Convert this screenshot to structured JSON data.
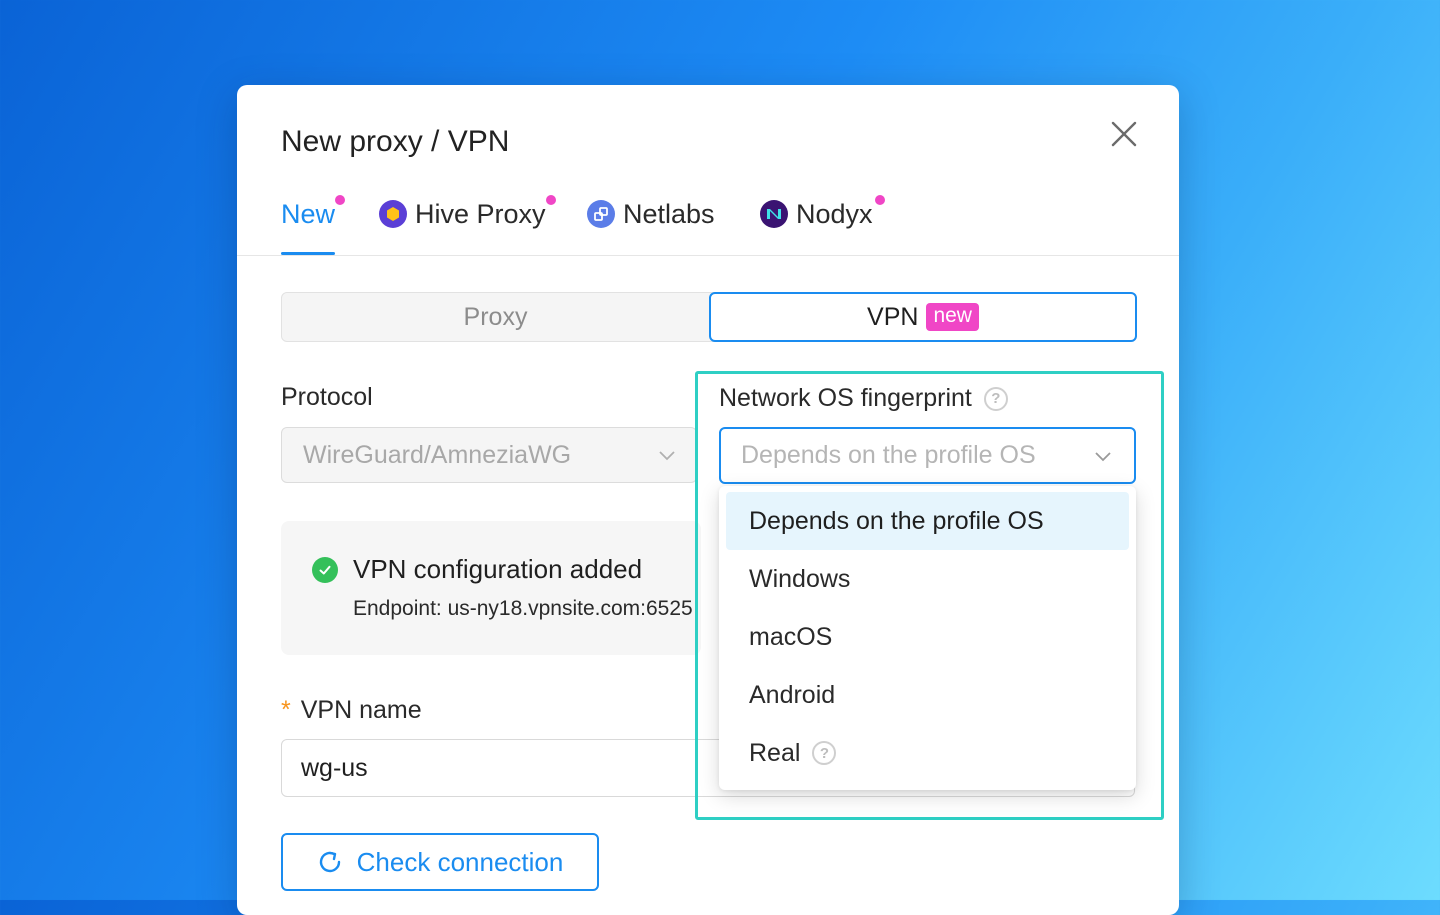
{
  "modal": {
    "title": "New proxy / VPN"
  },
  "tabs": [
    {
      "label": "New",
      "active": true,
      "dot": true
    },
    {
      "label": "Hive Proxy",
      "icon": "hexagon-logo-icon",
      "dot": true
    },
    {
      "label": "Netlabs",
      "icon": "netlabs-logo-icon",
      "dot": false
    },
    {
      "label": "Nodyx",
      "icon": "nodyx-logo-icon",
      "dot": true
    }
  ],
  "type_switch": {
    "proxy_label": "Proxy",
    "vpn_label": "VPN",
    "vpn_badge": "new",
    "selected": "VPN"
  },
  "protocol": {
    "label": "Protocol",
    "value": "WireGuard/AmneziaWG"
  },
  "status": {
    "title": "VPN configuration added",
    "endpoint": "Endpoint: us-ny18.vpnsite.com:6525"
  },
  "vpn_name": {
    "required_mark": "*",
    "label": "VPN name",
    "value": "wg-us"
  },
  "check_connection": {
    "label": "Check connection"
  },
  "fingerprint": {
    "label": "Network OS fingerprint",
    "help_glyph": "?",
    "placeholder": "Depends on the profile OS",
    "options": [
      {
        "label": "Depends on the profile OS",
        "selected": true
      },
      {
        "label": "Windows"
      },
      {
        "label": "macOS"
      },
      {
        "label": "Android"
      },
      {
        "label": "Real",
        "help": true
      }
    ]
  },
  "colors": {
    "accent": "#1a8cf0",
    "highlight": "#2ecfc4",
    "badge": "#f046c6",
    "success": "#34c05a"
  }
}
